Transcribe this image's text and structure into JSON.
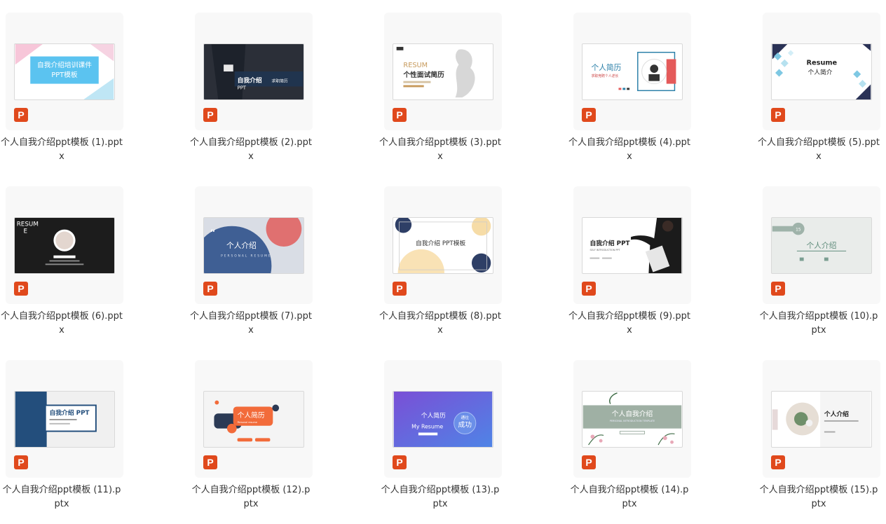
{
  "files": [
    {
      "name": "个人自我介绍ppt模板 (1).pptx",
      "thumb_title": "自我介绍培训课件",
      "thumb_subtitle": "PPT模板"
    },
    {
      "name": "个人自我介绍ppt模板 (2).pptx",
      "thumb_title": "自我介绍",
      "thumb_subtitle": "求职简历",
      "thumb_extra": "PPT"
    },
    {
      "name": "个人自我介绍ppt模板 (3).pptx",
      "thumb_title": "RESUM",
      "thumb_subtitle": "个性面试简历"
    },
    {
      "name": "个人自我介绍ppt模板 (4).pptx",
      "thumb_title": "个人简历",
      "thumb_subtitle": "求职竞聘个人述长"
    },
    {
      "name": "个人自我介绍ppt模板 (5).pptx",
      "thumb_title": "Resume",
      "thumb_subtitle": "个人简介"
    },
    {
      "name": "个人自我介绍ppt模板 (6).pptx",
      "thumb_title": "RESUM",
      "thumb_subtitle": "E"
    },
    {
      "name": "个人自我介绍ppt模板 (7).pptx",
      "thumb_title": "个人介绍",
      "thumb_subtitle": "PERSONAL RESUME"
    },
    {
      "name": "个人自我介绍ppt模板 (8).pptx",
      "thumb_title": "自我介绍 PPT模板"
    },
    {
      "name": "个人自我介绍ppt模板 (9).pptx",
      "thumb_title": "自我介绍 PPT",
      "thumb_subtitle": "SELF INTRODUCTION PPT"
    },
    {
      "name": "个人自我介绍ppt模板 (10).pptx",
      "thumb_title": "个人介绍",
      "thumb_extra": "15"
    },
    {
      "name": "个人自我介绍ppt模板 (11).pptx",
      "thumb_title": "自我介绍 PPT"
    },
    {
      "name": "个人自我介绍ppt模板 (12).pptx",
      "thumb_title": "个人简历",
      "thumb_subtitle": "Personal resume"
    },
    {
      "name": "个人自我介绍ppt模板 (13).pptx",
      "thumb_title": "个人简历",
      "thumb_subtitle": "My Resume",
      "thumb_extra": "成功",
      "thumb_extra2": "通往"
    },
    {
      "name": "个人自我介绍ppt模板 (14).pptx",
      "thumb_title": "个人自我介绍",
      "thumb_subtitle": "PERSONAL INTRODUCTION TEMPLATE"
    },
    {
      "name": "个人自我介绍ppt模板 (15).pptx",
      "thumb_title": "个人介绍"
    }
  ],
  "file_type_icon": "P",
  "file_type_icon_name": "powerpoint-icon",
  "colors": {
    "card_bg": "#f8f8f8",
    "ppt_orange": "#e0491c",
    "text": "#333333"
  }
}
